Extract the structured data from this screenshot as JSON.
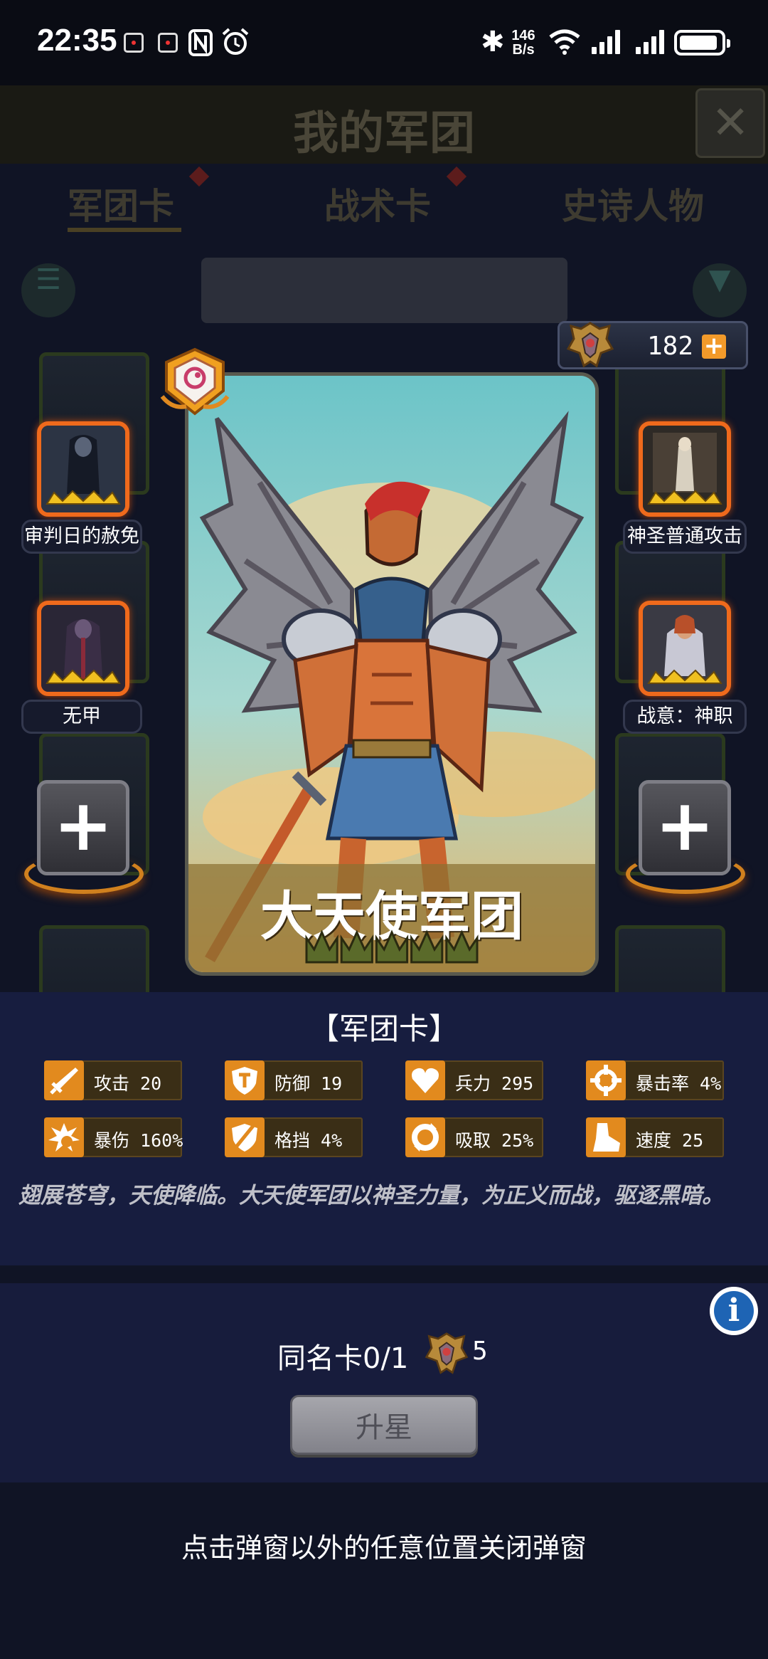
{
  "status_bar": {
    "time": "22:35",
    "net_speed_value": "146",
    "net_speed_unit": "B/s",
    "icons": [
      "notification-icon",
      "notification-icon",
      "nfc-icon",
      "alarm-icon",
      "bluetooth-icon",
      "wifi-icon",
      "signal-icon",
      "signal-icon",
      "battery-icon"
    ]
  },
  "background": {
    "title": "我的军团",
    "close": "✕",
    "tabs": [
      {
        "label": "军团卡"
      },
      {
        "label": "战术卡"
      },
      {
        "label": "史诗人物"
      }
    ]
  },
  "currency": {
    "value": "182",
    "plus": "+",
    "emblem": "legion-emblem-icon"
  },
  "card": {
    "name": "大天使军团",
    "stars": 5,
    "badge": "card-type-badge-icon"
  },
  "skills": {
    "left": [
      {
        "label": "审判日的赦免"
      },
      {
        "label": "无甲"
      }
    ],
    "right": [
      {
        "label": "神圣普通攻击"
      },
      {
        "label": "战意：神职"
      }
    ],
    "add_symbol": "+"
  },
  "info": {
    "section_title": "【军团卡】",
    "stats": [
      {
        "label": "攻击 20",
        "icon": "sword-icon"
      },
      {
        "label": "防御 19",
        "icon": "shield-icon"
      },
      {
        "label": "兵力 295",
        "icon": "heart-icon"
      },
      {
        "label": "暴击率 4%",
        "icon": "crosshair-icon"
      },
      {
        "label": "暴伤 160%",
        "icon": "burst-icon"
      },
      {
        "label": "格挡 4%",
        "icon": "block-icon"
      },
      {
        "label": "吸取 25%",
        "icon": "absorb-icon"
      },
      {
        "label": "速度 25",
        "icon": "boot-icon"
      }
    ],
    "description": "翅展苍穹，天使降临。大天使军团以神圣力量，为正义而战，驱逐黑暗。"
  },
  "upgrade": {
    "same_card_label": "同名卡0/1",
    "cost": "5",
    "button": "升星",
    "info_symbol": "i"
  },
  "hint": "点击弹窗以外的任意位置关闭弹窗",
  "colors": {
    "accent_orange": "#ef6a1c",
    "panel": "#171d3f",
    "stat_icon": "#e28a1e",
    "card_band": "#8a7032"
  }
}
